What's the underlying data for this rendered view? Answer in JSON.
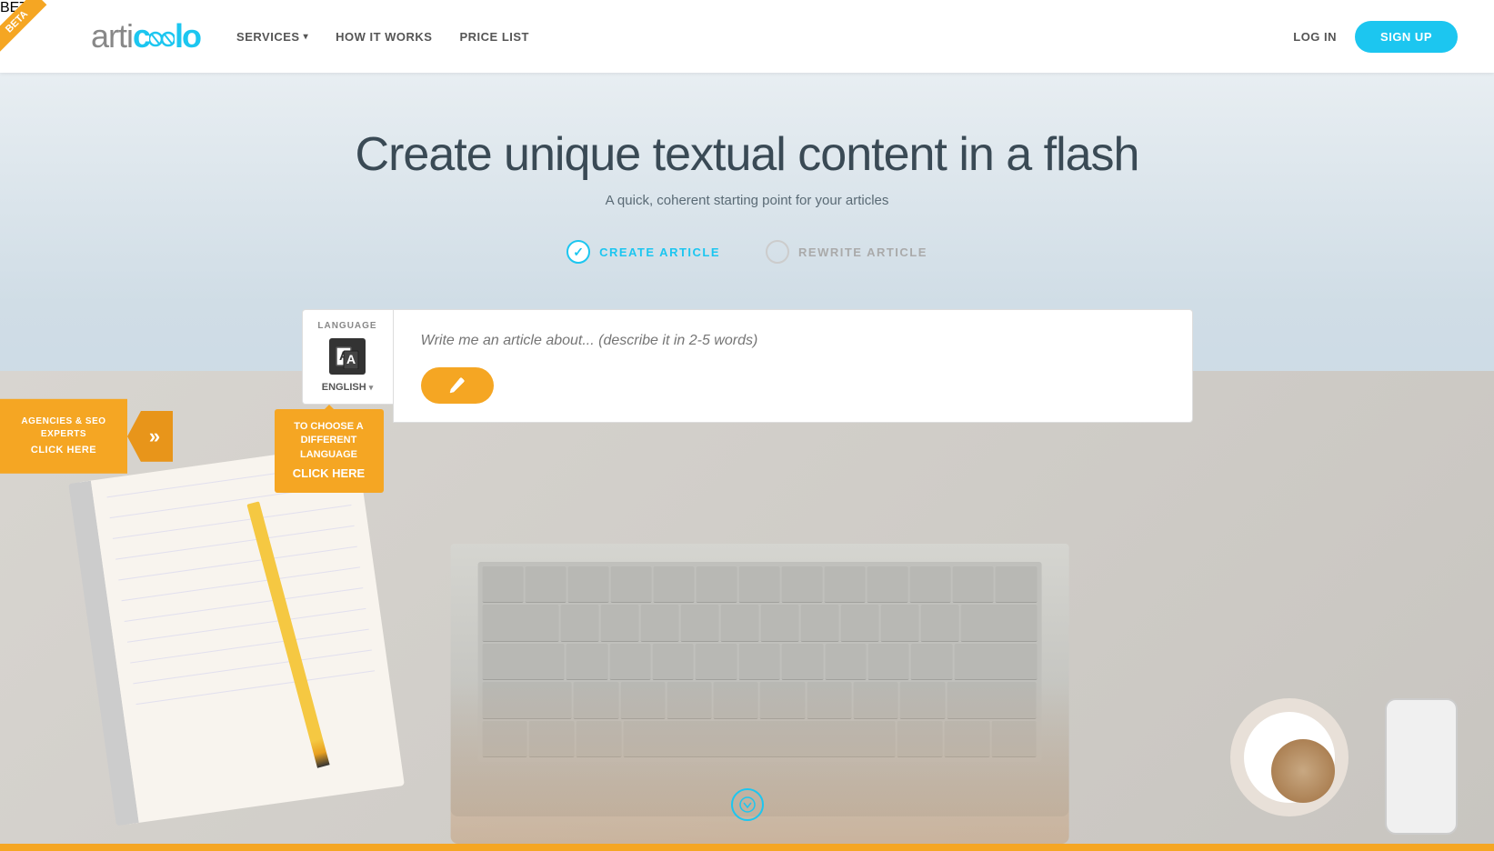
{
  "header": {
    "logo": {
      "part1": "arti",
      "part2": "oo",
      "part3": "l",
      "part4": "lo",
      "full": "articoolo"
    },
    "beta_badge": "BETA",
    "nav": {
      "services": "SERVICES",
      "how_it_works": "HOW IT WORKS",
      "price_list": "PRICE LIST"
    },
    "login": "LOG IN",
    "signup": "SIGN UP"
  },
  "hero": {
    "title": "Create unique textual content in a flash",
    "subtitle": "A quick, coherent starting point for your articles",
    "option1": "CREATE ARTICLE",
    "option2": "REWRITE ARTICLE",
    "input_placeholder": "Write me an article about... (describe it in 2-5 words)"
  },
  "language_panel": {
    "label": "LANGUAGE",
    "selected": "ENGLISH",
    "icon": "🌐"
  },
  "tooltip_language": {
    "line1": "TO CHOOSE A",
    "line2": "DIFFERENT LANGUAGE",
    "click": "CLICK HERE"
  },
  "agencies": {
    "line1": "AGENCIES & SEO EXPERTS",
    "line2": "CLICK HERE"
  },
  "scroll_down": "↓",
  "footer_bar_color": "#f5a623",
  "colors": {
    "brand_blue": "#1cc6f0",
    "brand_orange": "#f5a623",
    "text_dark": "#3a4a55",
    "text_mid": "#5a6a75",
    "bg_gradient_top": "#e8eef2",
    "bg_gradient_bottom": "#c0cdd6"
  }
}
